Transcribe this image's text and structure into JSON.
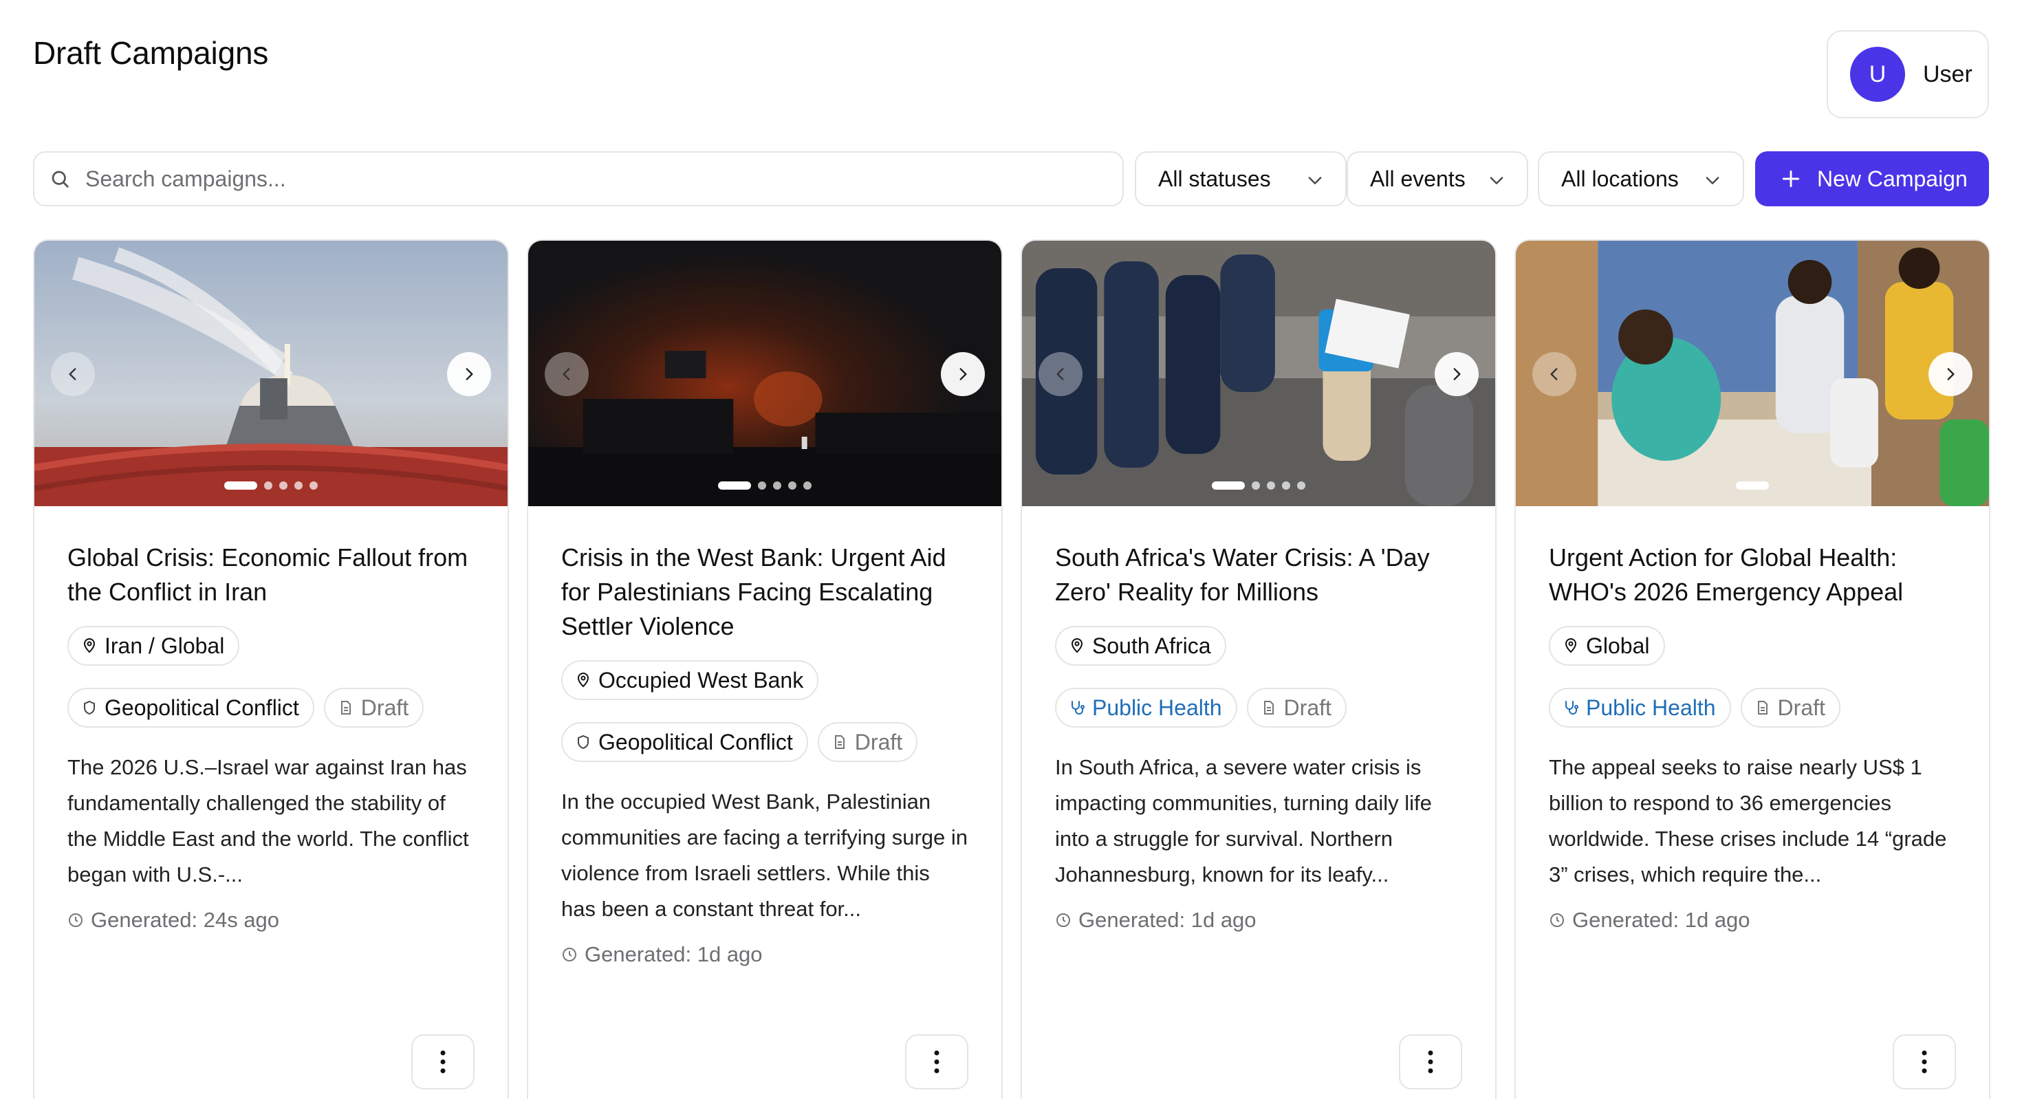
{
  "header": {
    "title": "Draft Campaigns"
  },
  "user": {
    "initial": "U",
    "name": "User"
  },
  "toolbar": {
    "search_placeholder": "Search campaigns...",
    "filters": [
      "All statuses",
      "All events",
      "All locations"
    ],
    "new_label": "New Campaign"
  },
  "colors": {
    "accent": "#4a34e8",
    "health_chip": "#1f6db8"
  },
  "cards": [
    {
      "title": "Global Crisis: Economic Fallout from the Conflict in Iran",
      "location": "Iran / Global",
      "category": "Geopolitical Conflict",
      "category_icon": "shield-icon",
      "status": "Draft",
      "description": "The 2026 U.S.–Israel war against Iran has fundamentally challenged the stability of the Middle East and the world. The conflict began with U.S.-...",
      "generated": "Generated: 24s ago",
      "image_dots": 5,
      "active_dot": 0
    },
    {
      "title": "Crisis in the West Bank: Urgent Aid for Palestinians Facing Escalating Settler Violence",
      "location": "Occupied West Bank",
      "category": "Geopolitical Conflict",
      "category_icon": "shield-icon",
      "status": "Draft",
      "description": "In the occupied West Bank, Palestinian communities are facing a terrifying surge in violence from Israeli settlers. While this has been a constant threat for...",
      "generated": "Generated: 1d ago",
      "image_dots": 5,
      "active_dot": 0
    },
    {
      "title": "South Africa's Water Crisis: A 'Day Zero' Reality for Millions",
      "location": "South Africa",
      "category": "Public Health",
      "category_icon": "stethoscope-icon",
      "status": "Draft",
      "description": "In South Africa, a severe water crisis is impacting communities, turning daily life into a struggle for survival. Northern Johannesburg, known for its leafy...",
      "generated": "Generated: 1d ago",
      "image_dots": 5,
      "active_dot": 0
    },
    {
      "title": "Urgent Action for Global Health: WHO's 2026 Emergency Appeal",
      "location": "Global",
      "category": "Public Health",
      "category_icon": "stethoscope-icon",
      "status": "Draft",
      "description": "The appeal seeks to raise nearly US$ 1 billion to respond to 36 emergencies worldwide. These crises include 14 “grade 3” crises, which require the...",
      "generated": "Generated: 1d ago",
      "image_dots": 1,
      "active_dot": 0
    }
  ]
}
